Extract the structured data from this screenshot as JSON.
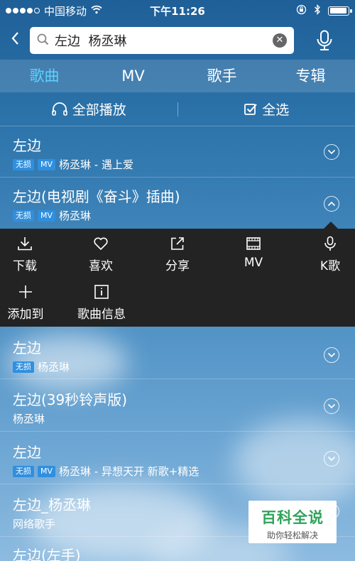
{
  "status_bar": {
    "carrier": "中国移动",
    "time": "下午11:26"
  },
  "search": {
    "value": "左边  杨丞琳",
    "placeholder": ""
  },
  "tabs": [
    {
      "label": "歌曲",
      "active": true
    },
    {
      "label": "MV",
      "active": false
    },
    {
      "label": "歌手",
      "active": false
    },
    {
      "label": "专辑",
      "active": false
    }
  ],
  "actions": {
    "play_all": "全部播放",
    "select_all": "全选"
  },
  "songs": [
    {
      "title": "左边",
      "badges": [
        "无损",
        "MV"
      ],
      "meta": "杨丞琳 - 遇上爱",
      "icon": "chevron-down-icon"
    },
    {
      "title": "左边(电视剧《奋斗》插曲)",
      "badges": [
        "无损",
        "MV"
      ],
      "meta": "杨丞琳",
      "icon": "chevron-up-icon"
    },
    {
      "title": "左边",
      "badges": [
        "无损"
      ],
      "meta": "杨丞琳",
      "icon": "chevron-down-icon"
    },
    {
      "title": "左边(39秒铃声版)",
      "badges": [],
      "meta": "杨丞琳",
      "icon": "chevron-down-icon"
    },
    {
      "title": "左边",
      "badges": [
        "无损",
        "MV"
      ],
      "meta": "杨丞琳 - 异想天开 新歌+精选",
      "icon": "chevron-down-icon"
    },
    {
      "title": "左边_杨丞琳",
      "badges": [],
      "meta": "网络歌手",
      "icon": "chevron-down-icon"
    },
    {
      "title": "左边(左手)",
      "badges": [],
      "meta": "",
      "icon": "chevron-down-icon"
    }
  ],
  "panel_ops": [
    {
      "label": "下载",
      "icon": "download-icon"
    },
    {
      "label": "喜欢",
      "icon": "heart-icon"
    },
    {
      "label": "分享",
      "icon": "share-icon"
    },
    {
      "label": "MV",
      "icon": "video-icon"
    },
    {
      "label": "K歌",
      "icon": "microphone-icon"
    },
    {
      "label": "添加到",
      "icon": "plus-icon"
    },
    {
      "label": "歌曲信息",
      "icon": "info-icon"
    }
  ],
  "watermark": {
    "main": "百科全说",
    "sub": "助你轻松解决"
  },
  "colors": {
    "active_tab": "#5fd1ff",
    "badge": "#2f8fe0",
    "panel_bg": "#232323",
    "watermark_green": "#2fa35a"
  }
}
